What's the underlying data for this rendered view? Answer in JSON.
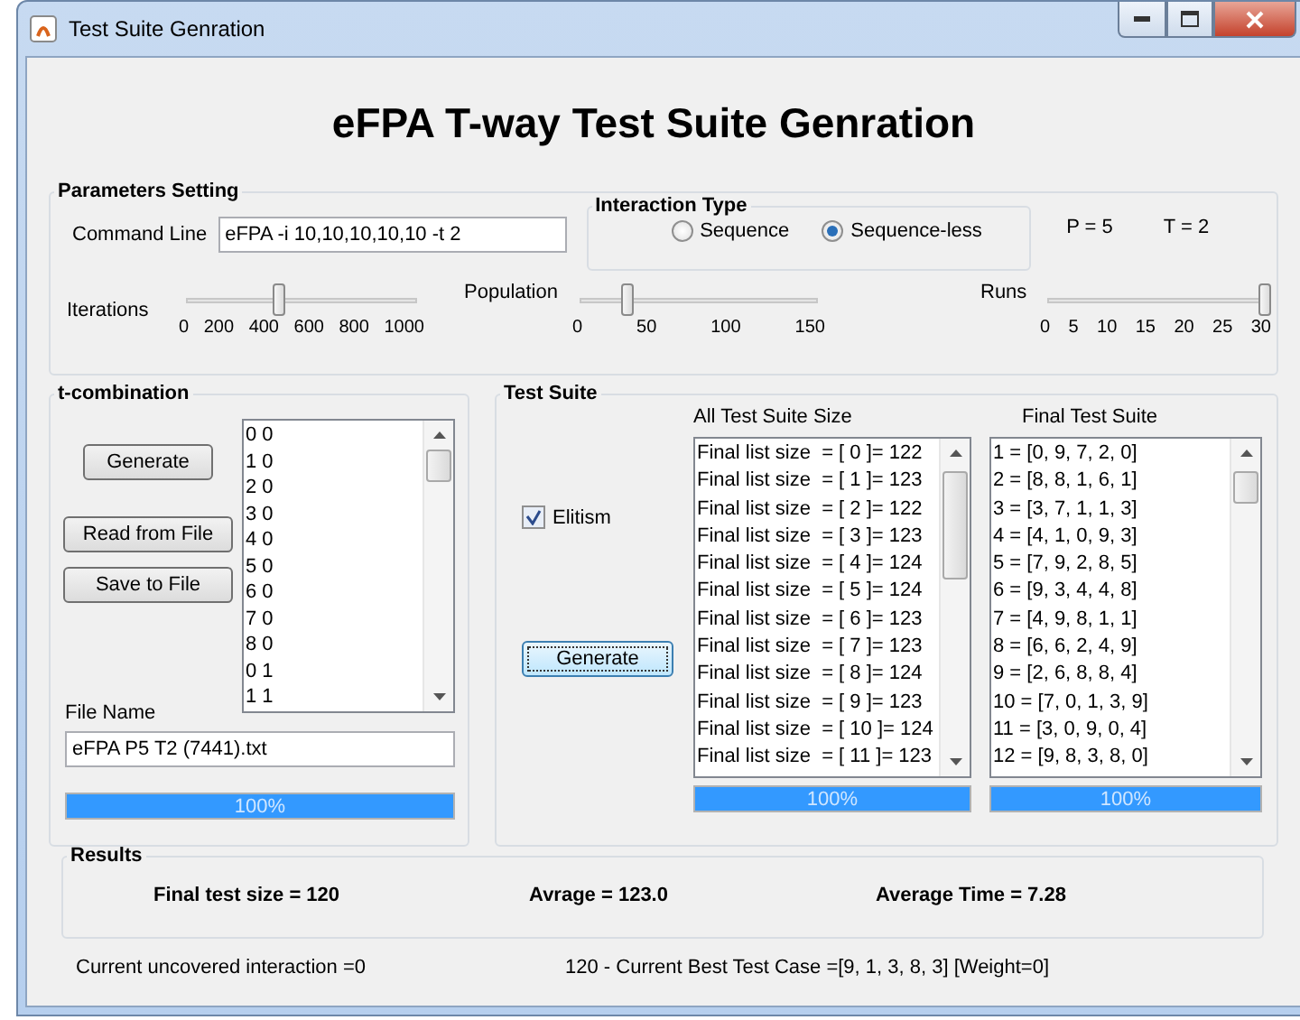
{
  "window": {
    "title": "Test Suite Genration"
  },
  "heading": "eFPA T-way Test Suite Genration",
  "parameters": {
    "title": "Parameters Setting",
    "command_line": {
      "label": "Command Line",
      "value": "eFPA -i 10,10,10,10,10 -t 2"
    },
    "interaction_type": {
      "title": "Interaction Type",
      "options": [
        {
          "label": "Sequence",
          "selected": false
        },
        {
          "label": "Sequence-less",
          "selected": true
        }
      ]
    },
    "p_value": "P = 5",
    "t_value": "T = 2",
    "sliders": [
      {
        "label": "Iterations",
        "level": 0.4,
        "ticks": [
          "0",
          "200",
          "400",
          "600",
          "800",
          "1000"
        ]
      },
      {
        "label": "Population",
        "level": 0.2,
        "ticks": [
          "0",
          "50",
          "100",
          "150"
        ]
      },
      {
        "label": "Runs",
        "level": 1,
        "ticks": [
          "0",
          "5",
          "10",
          "15",
          "20",
          "25",
          "30"
        ]
      }
    ]
  },
  "t_combination": {
    "title": "t-combination",
    "buttons": [
      "Generate",
      "Read from File",
      "Save to File"
    ],
    "list": [
      "0 0",
      "1 0",
      "2 0",
      "3 0",
      "4 0",
      "5 0",
      "6 0",
      "7 0",
      "8 0",
      "0 1",
      "1 1"
    ],
    "file_name": {
      "label": "File Name",
      "value": "eFPA P5 T2 (7441).txt"
    },
    "progress": {
      "level": 1,
      "text": "100%"
    }
  },
  "test_suite": {
    "title": "Test Suite",
    "elitism": {
      "label": "Elitism",
      "checked": true
    },
    "generate": "Generate",
    "lists": [
      {
        "header": "All Test Suite Size",
        "items": [
          "Final list size  = [ 0 ]= 122",
          "Final list size  = [ 1 ]= 123",
          "Final list size  = [ 2 ]= 122",
          "Final list size  = [ 3 ]= 123",
          "Final list size  = [ 4 ]= 124",
          "Final list size  = [ 5 ]= 124",
          "Final list size  = [ 6 ]= 123",
          "Final list size  = [ 7 ]= 123",
          "Final list size  = [ 8 ]= 124",
          "Final list size  = [ 9 ]= 123",
          "Final list size  = [ 10 ]= 124",
          "Final list size  = [ 11 ]= 123"
        ],
        "progress": {
          "level": 1,
          "text": "100%"
        }
      },
      {
        "header": "Final Test Suite",
        "items": [
          "1 = [0, 9, 7, 2, 0]",
          "2 = [8, 8, 1, 6, 1]",
          "3 = [3, 7, 1, 1, 3]",
          "4 = [4, 1, 0, 9, 3]",
          "5 = [7, 9, 2, 8, 5]",
          "6 = [9, 3, 4, 4, 8]",
          "7 = [4, 9, 8, 1, 1]",
          "8 = [6, 6, 2, 4, 9]",
          "9 = [2, 6, 8, 8, 4]",
          "10 = [7, 0, 1, 3, 9]",
          "11 = [3, 0, 9, 0, 4]",
          "12 = [9, 8, 3, 8, 0]"
        ],
        "progress": {
          "level": 1,
          "text": "100%"
        }
      }
    ]
  },
  "results": {
    "title": "Results",
    "values": [
      "Final test size = 120",
      "Avrage = 123.0",
      "Average Time = 7.28"
    ]
  },
  "status": [
    "Current uncovered interaction =0",
    "120 - Current Best Test Case  =[9, 1, 3, 8, 3] [Weight=0]"
  ]
}
